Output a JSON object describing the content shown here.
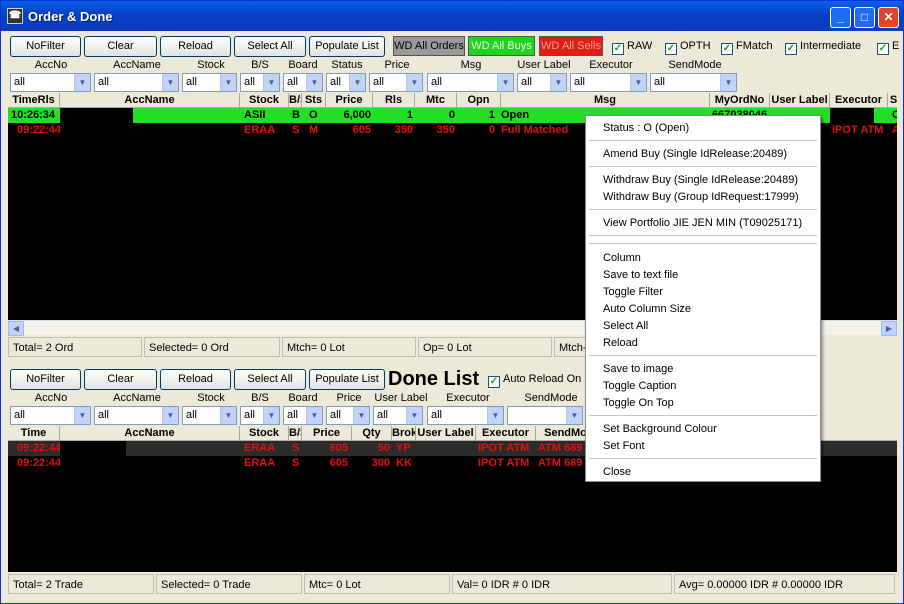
{
  "window": {
    "title": "Order & Done"
  },
  "toolbar": {
    "nofilter": "NoFilter",
    "clear": "Clear",
    "reload": "Reload",
    "select_all": "Select All",
    "populate": "Populate List",
    "wd_all_orders": "WD All Orders",
    "wd_all_buys": "WD All Buys",
    "wd_all_sells": "WD All Sells",
    "checks": [
      "RAW",
      "OPTH",
      "FMatch",
      "Intermediate",
      "E"
    ]
  },
  "colors": {
    "open_row": "#21e021",
    "red_text": "#e01010",
    "wd_orders": "#9a9a9a",
    "wd_buys": "#21d421",
    "wd_sells": "#e01f14"
  },
  "order_filter": {
    "labels": [
      "AccNo",
      "AccName",
      "Stock",
      "B/S",
      "Board",
      "Status",
      "Price",
      "Msg",
      "User Label",
      "Executor",
      "SendMode"
    ],
    "values": [
      "all",
      "all",
      "all",
      "all",
      "all",
      "all",
      "all",
      "all",
      "all",
      "all",
      "all"
    ]
  },
  "order_grid": {
    "headers": [
      "TimeRls",
      "AccName",
      "Stock",
      "B/S",
      "Sts",
      "Price",
      "Rls",
      "Mtc",
      "Opn",
      "Msg",
      "MyOrdNo",
      "User Label",
      "Executor",
      "S"
    ],
    "rows": [
      {
        "time": "10:26:34",
        "stock": "ASII",
        "bs": "B",
        "sts": "O",
        "price": "6,000",
        "rls": "1",
        "mtc": "0",
        "opn": "1",
        "msg": "Open",
        "myordno": "667038046",
        "executor": "",
        "extra": "C"
      },
      {
        "time": "09:22:44",
        "stock": "ERAA",
        "bs": "S",
        "sts": "M",
        "price": "605",
        "rls": "350",
        "mtc": "350",
        "opn": "0",
        "msg": "Full Matched",
        "myordno": "",
        "executor": "IPOT ATM",
        "extra": "A"
      }
    ]
  },
  "order_status": {
    "total": "Total= 2 Ord",
    "selected": "Selected= 0 Ord",
    "mtch": "Mtch= 0 Lot",
    "op": "Op= 0 Lot",
    "mtch2": "Mtch-"
  },
  "done": {
    "title": "Done List",
    "auto_reload": "Auto Reload On",
    "nofilter": "NoFilter",
    "clear": "Clear",
    "reload": "Reload",
    "select_all": "Select All",
    "populate": "Populate List",
    "filter_labels": [
      "AccNo",
      "AccName",
      "Stock",
      "B/S",
      "Board",
      "Price",
      "User Label",
      "Executor",
      "SendMode"
    ],
    "filter_values": [
      "all",
      "all",
      "all",
      "all",
      "all",
      "all",
      "all",
      "all"
    ],
    "headers": [
      "Time",
      "AccName",
      "Stock",
      "B/S",
      "Price",
      "Qty",
      "Brok",
      "User Label",
      "Executor",
      "SendMo"
    ],
    "rows": [
      {
        "time": "09:22:44",
        "stock": "ERAA",
        "bs": "S",
        "price": "605",
        "qty": "50",
        "brok": "YP",
        "executor": "IPOT ATM",
        "sendmode": "ATM 689"
      },
      {
        "time": "09:22:44",
        "stock": "ERAA",
        "bs": "S",
        "price": "605",
        "qty": "300",
        "brok": "KK",
        "executor": "IPOT ATM",
        "sendmode": "ATM 689"
      }
    ]
  },
  "done_status": {
    "total": "Total= 2 Trade",
    "selected": "Selected= 0 Trade",
    "mtc": "Mtc= 0 Lot",
    "val": "Val= 0 IDR # 0 IDR",
    "avg": "Avg= 0.00000 IDR # 0.00000 IDR"
  },
  "context_menu": {
    "status": "Status : O (Open)",
    "amend": "Amend Buy (Single IdRelease:20489)",
    "withdraw_single": "Withdraw Buy (Single IdRelease:20489)",
    "withdraw_group": "Withdraw Buy (Group IdRequest:17999)",
    "view_portfolio": "View Portfolio JIE JEN MIN (T09025171)",
    "column": "Column",
    "save_text": "Save to text file",
    "toggle_filter": "Toggle Filter",
    "auto_col": "Auto Column Size",
    "select_all": "Select All",
    "reload": "Reload",
    "save_image": "Save to image",
    "toggle_caption": "Toggle Caption",
    "toggle_top": "Toggle On Top",
    "set_bg": "Set Background Colour",
    "set_font": "Set Font",
    "close": "Close"
  }
}
